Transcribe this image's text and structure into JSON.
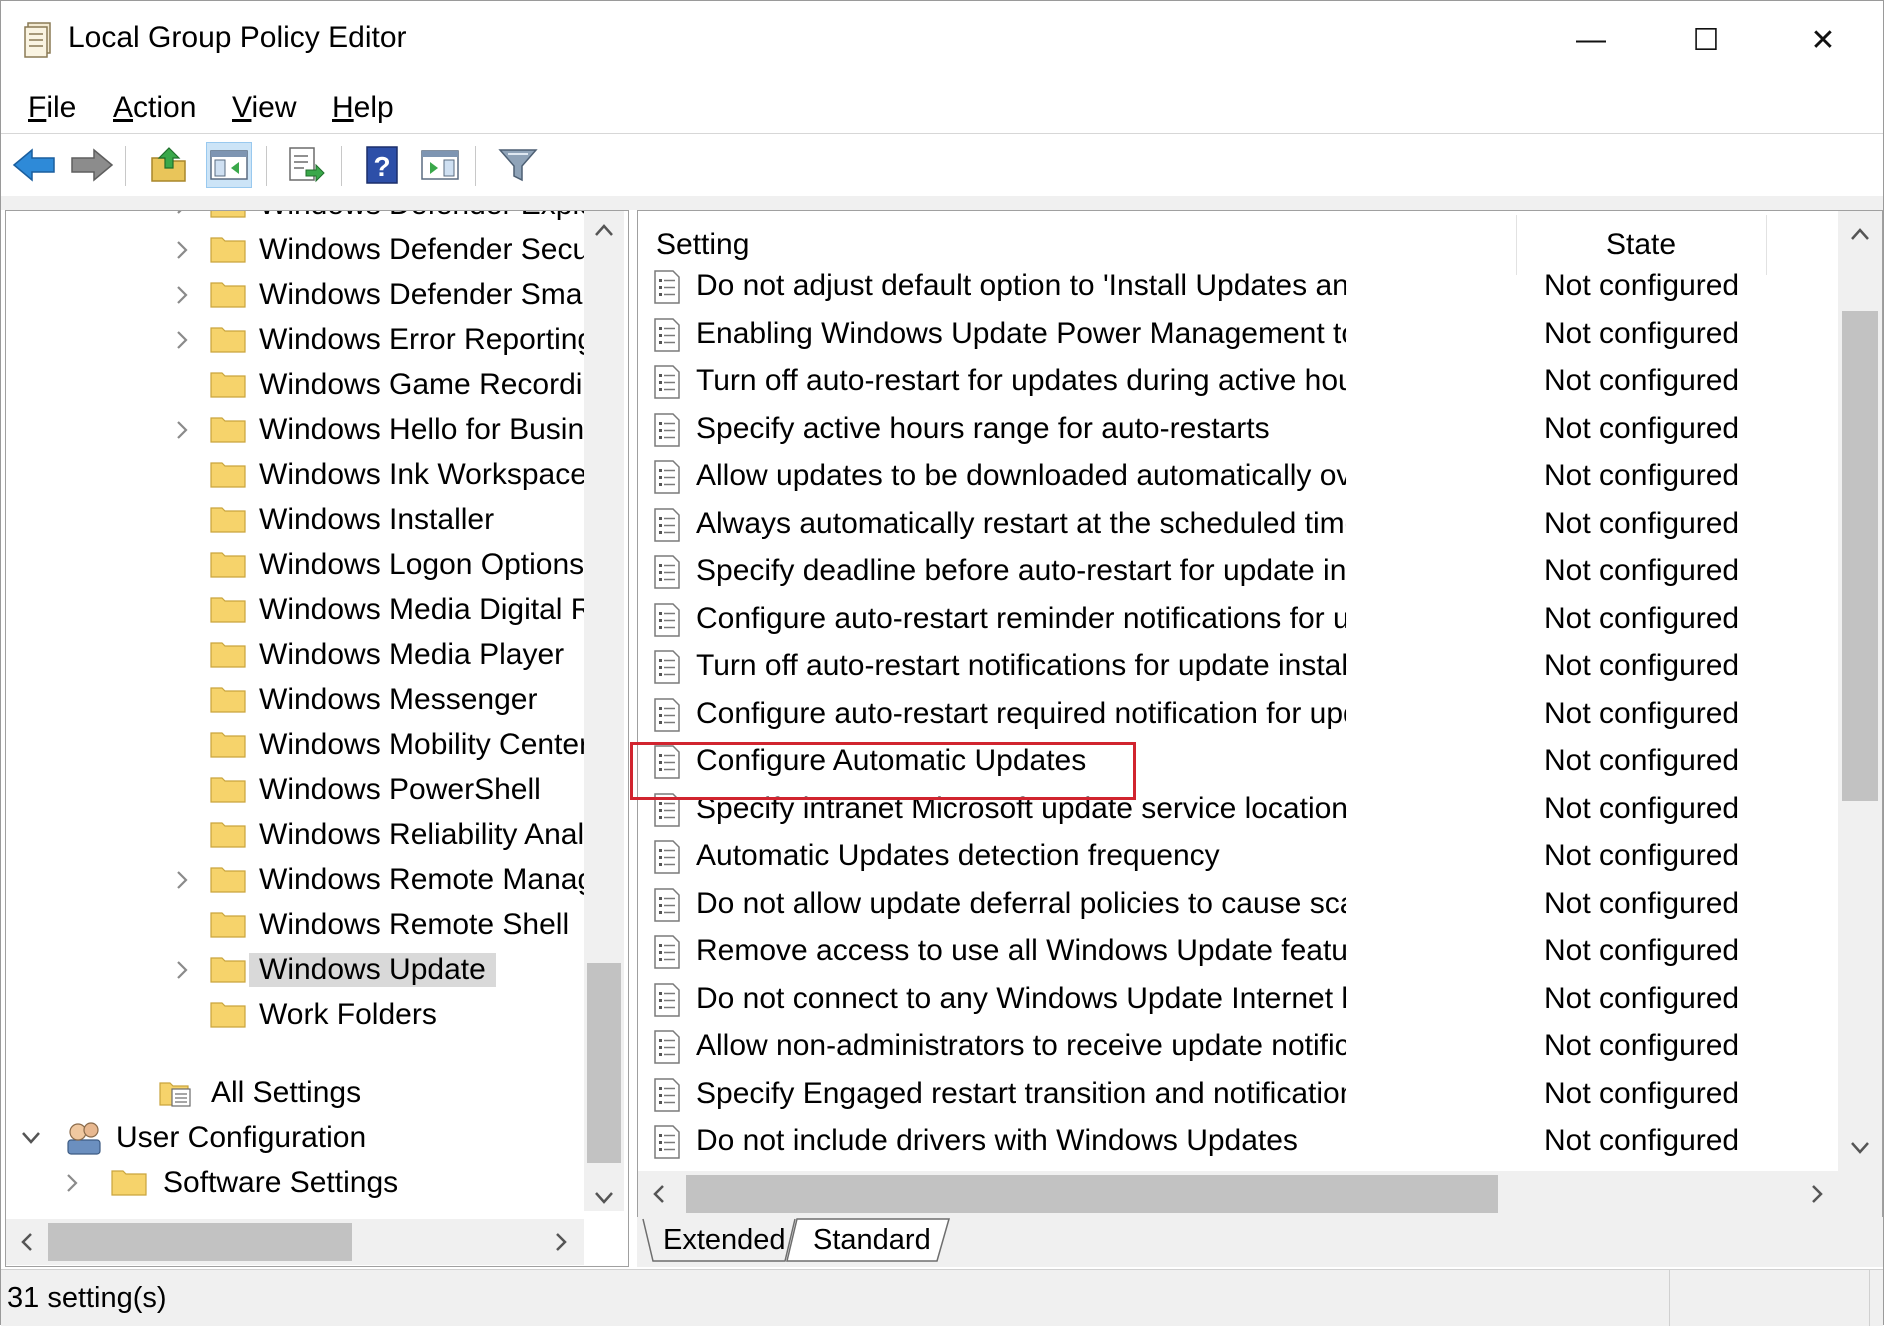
{
  "window": {
    "title": "Local Group Policy Editor",
    "minimize": "—",
    "maximize": "☐",
    "close": "✕"
  },
  "menu": {
    "file": {
      "key": "F",
      "rest": "ile"
    },
    "action": {
      "key": "A",
      "rest": "ction"
    },
    "view": {
      "key": "V",
      "rest": "iew"
    },
    "help": {
      "key": "H",
      "rest": "elp"
    }
  },
  "toolbar": [
    {
      "name": "back-button",
      "icon": "back-arrow-icon"
    },
    {
      "name": "forward-button",
      "icon": "forward-arrow-icon"
    },
    {
      "name": "up-one-level-button",
      "icon": "folder-up-icon"
    },
    {
      "name": "show-hide-console-tree-button",
      "icon": "console-tree-icon"
    },
    {
      "name": "export-list-button",
      "icon": "export-list-icon"
    },
    {
      "name": "help-button",
      "icon": "help-icon"
    },
    {
      "name": "show-hide-action-pane-button",
      "icon": "action-pane-icon"
    },
    {
      "name": "filter-options-button",
      "icon": "filter-icon"
    }
  ],
  "tree": {
    "items": [
      {
        "label": "Windows Defender Exploi",
        "expander": true
      },
      {
        "label": "Windows Defender Securi",
        "expander": true
      },
      {
        "label": "Windows Defender Smart",
        "expander": true
      },
      {
        "label": "Windows Error Reporting",
        "expander": true
      },
      {
        "label": "Windows Game Recordin",
        "expander": false
      },
      {
        "label": "Windows Hello for Busine",
        "expander": true
      },
      {
        "label": "Windows Ink Workspace",
        "expander": false
      },
      {
        "label": "Windows Installer",
        "expander": false
      },
      {
        "label": "Windows Logon Options",
        "expander": false
      },
      {
        "label": "Windows Media Digital R",
        "expander": false
      },
      {
        "label": "Windows Media Player",
        "expander": false
      },
      {
        "label": "Windows Messenger",
        "expander": false
      },
      {
        "label": "Windows Mobility Center",
        "expander": false
      },
      {
        "label": "Windows PowerShell",
        "expander": false
      },
      {
        "label": "Windows Reliability Analy",
        "expander": false
      },
      {
        "label": "Windows Remote Manag",
        "expander": true
      },
      {
        "label": "Windows Remote Shell",
        "expander": false
      },
      {
        "label": "Windows Update",
        "expander": true,
        "selected": true
      },
      {
        "label": "Work Folders",
        "expander": false
      }
    ],
    "all_settings": "All Settings",
    "user_configuration": "User Configuration",
    "software_settings": "Software Settings"
  },
  "list": {
    "col_setting": "Setting",
    "col_state": "State",
    "rows": [
      {
        "name": "Do not adjust default option to 'Install Updates and Shut Down...",
        "state": "Not configured"
      },
      {
        "name": "Enabling Windows Update Power Management to automatical...",
        "state": "Not configured"
      },
      {
        "name": "Turn off auto-restart for updates during active hours",
        "state": "Not configured"
      },
      {
        "name": "Specify active hours range for auto-restarts",
        "state": "Not configured"
      },
      {
        "name": "Allow updates to be downloaded automatically over metered ...",
        "state": "Not configured"
      },
      {
        "name": "Always automatically restart at the scheduled time",
        "state": "Not configured"
      },
      {
        "name": "Specify deadline before auto-restart for update installation",
        "state": "Not configured"
      },
      {
        "name": "Configure auto-restart reminder notifications for updates",
        "state": "Not configured"
      },
      {
        "name": "Turn off auto-restart notifications for update installations",
        "state": "Not configured"
      },
      {
        "name": "Configure auto-restart required notification for updates",
        "state": "Not configured"
      },
      {
        "name": "Configure Automatic Updates",
        "state": "Not configured",
        "highlighted": true
      },
      {
        "name": "Specify intranet Microsoft update service location",
        "state": "Not configured"
      },
      {
        "name": "Automatic Updates detection frequency",
        "state": "Not configured"
      },
      {
        "name": "Do not allow update deferral policies to cause scans against W...",
        "state": "Not configured"
      },
      {
        "name": "Remove access to use all Windows Update features",
        "state": "Not configured"
      },
      {
        "name": "Do not connect to any Windows Update Internet locations",
        "state": "Not configured"
      },
      {
        "name": "Allow non-administrators to receive update notifications",
        "state": "Not configured"
      },
      {
        "name": "Specify Engaged restart transition and notification schedule for...",
        "state": "Not configured"
      },
      {
        "name": "Do not include drivers with Windows Updates",
        "state": "Not configured"
      }
    ]
  },
  "tabs": {
    "extended": "Extended",
    "standard": "Standard"
  },
  "status": {
    "text": "31 setting(s)"
  },
  "colors": {
    "highlight_border": "#d1242f",
    "folder": "#f6d36b",
    "selection": "#d9d9d9"
  }
}
